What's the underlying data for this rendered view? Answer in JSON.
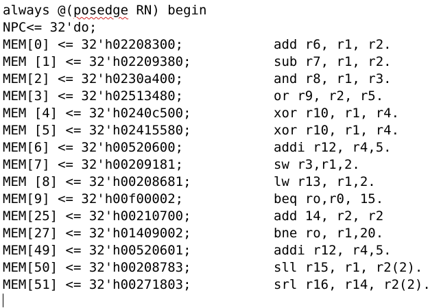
{
  "editor": {
    "header": {
      "before": "always @(",
      "misspelled": "posedge",
      "after": " RN) begin"
    },
    "npc_line": "NPC<= 32'do;",
    "memory_lines": [
      {
        "left": "MEM[0] <= 32'h02208300;",
        "right": "add r6, r1, r2."
      },
      {
        "left": "MEM [1] <= 32'h02209380;",
        "right": "sub r7, r1, r2."
      },
      {
        "left": "MEM[2] <= 32'h0230a400;",
        "right": "and r8, r1, r3."
      },
      {
        "left": "MEM[3] <= 32'h02513480;",
        "right": "or r9, r2, r5."
      },
      {
        "left": "MEM [4] <= 32'h0240c500;",
        "right": "xor r10, r1, r4."
      },
      {
        "left": "MEM [5] <= 32'h02415580;",
        "right": "xor r10, r1, r4."
      },
      {
        "left": "MEM[6] <= 32'h00520600;",
        "right": "addi r12, r4,5."
      },
      {
        "left": "MEM[7] <= 32'h00209181;",
        "right": "sw r3,r1,2."
      },
      {
        "left": "MEM [8] <= 32'h00208681;",
        "right": "lw r13, r1,2."
      },
      {
        "left": "MEM[9] <= 32'h00f00002;",
        "right": "beq ro,r0, 15."
      },
      {
        "left": "MEM[25] <= 32'h00210700;",
        "right": "add 14, r2, r2"
      },
      {
        "left": "MEM[27] <= 32'h01409002;",
        "right": "bne ro, r1,20."
      },
      {
        "left": "MEM[49] <= 32'h00520601;",
        "right": "addi r12, r4,5."
      },
      {
        "left": "MEM[50] <= 32'h00208783;",
        "right": "sll r15, r1, r2(2)."
      },
      {
        "left": "MEM[51] <= 32'h00271803;",
        "right": "srl r16, r14, r2(2)."
      }
    ]
  }
}
